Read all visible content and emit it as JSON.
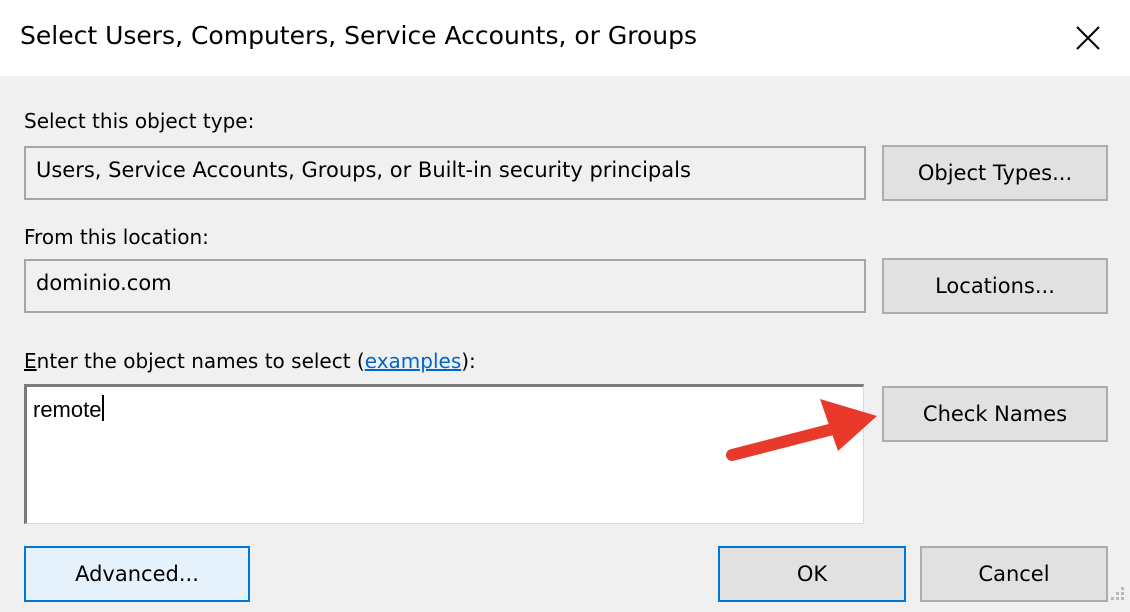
{
  "window": {
    "title": "Select Users, Computers, Service Accounts, or Groups",
    "close_icon": "close-icon"
  },
  "object_type": {
    "label": "Select this object type:",
    "value": "Users, Service Accounts, Groups, or Built-in security principals",
    "button_label": "Object Types..."
  },
  "location": {
    "label": "From this location:",
    "value": "dominio.com",
    "button_label": "Locations..."
  },
  "names": {
    "label_accesskey": "E",
    "label_prefix": "nter the object names to select (",
    "label_link": "examples",
    "label_suffix": "):",
    "value": "remote",
    "check_names_label": "Check Names"
  },
  "footer": {
    "advanced_label": "Advanced...",
    "ok_label": "OK",
    "cancel_label": "Cancel"
  },
  "annotation": {
    "arrow_color": "#e8392a",
    "arrow_icon": "red-arrow-icon"
  },
  "colors": {
    "accent": "#0078d7",
    "link": "#0066cc",
    "button_face": "#e1e1e1",
    "dialog_bg": "#f0f0f0"
  }
}
